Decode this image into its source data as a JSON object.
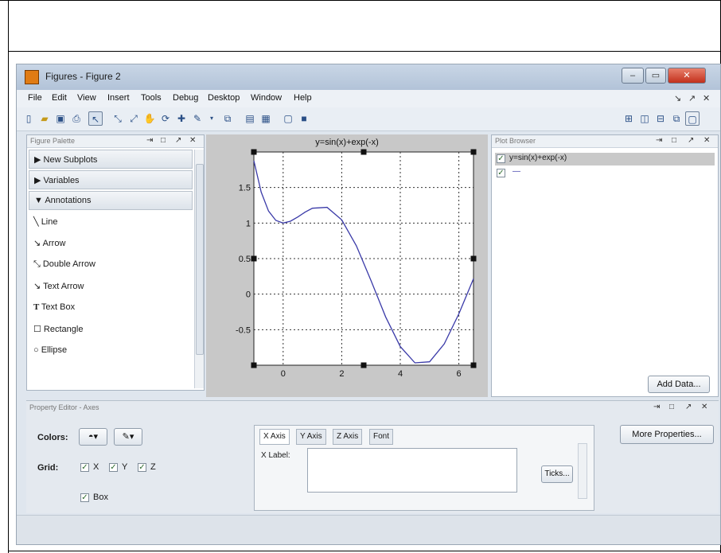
{
  "window": {
    "title": "Figures - Figure 2"
  },
  "menu": [
    "File",
    "Edit",
    "View",
    "Insert",
    "Tools",
    "Debug",
    "Desktop",
    "Window",
    "Help"
  ],
  "menu_right": [
    "↘",
    "↗",
    "✕"
  ],
  "palette": {
    "title": "Figure Palette",
    "sections": [
      "New Subplots",
      "Variables",
      "Annotations"
    ],
    "annotations": [
      "Line",
      "Arrow",
      "Double Arrow",
      "Text Arrow",
      "Text Box",
      "Rectangle",
      "Ellipse"
    ]
  },
  "plot": {
    "title": "y=sin(x)+exp(-x)",
    "yticks": [
      "1.5",
      "1",
      "0.5",
      "0",
      "-0.5"
    ],
    "xticks": [
      "0",
      "2",
      "4",
      "6"
    ]
  },
  "chart_data": {
    "type": "line",
    "title": "y=sin(x)+exp(-x)",
    "xlabel": "",
    "ylabel": "",
    "xlim": [
      -1,
      6.5
    ],
    "ylim": [
      -1,
      2
    ],
    "grid": true,
    "series": [
      {
        "name": "y=sin(x)+exp(-x)",
        "x": [
          -1,
          -0.75,
          -0.5,
          -0.25,
          0,
          0.25,
          0.5,
          0.75,
          1,
          1.5,
          2,
          2.5,
          3,
          3.5,
          4,
          4.5,
          5,
          5.5,
          6,
          6.5
        ],
        "y": [
          1.877,
          1.436,
          1.169,
          1.037,
          1.0,
          1.026,
          1.086,
          1.154,
          1.209,
          1.221,
          1.045,
          0.68,
          0.191,
          -0.321,
          -0.738,
          -0.966,
          -0.952,
          -0.701,
          -0.277,
          0.217
        ]
      }
    ],
    "color": "#3a3aa8"
  },
  "browser": {
    "title": "Plot Browser",
    "items": [
      "y=sin(x)+exp(-x)",
      "—"
    ],
    "add_data": "Add Data..."
  },
  "property_editor": {
    "title": "Property Editor - Axes",
    "colors_label": "Colors:",
    "grid_label": "Grid:",
    "grid_x": "X",
    "grid_y": "Y",
    "grid_z": "Z",
    "box": "Box",
    "tabs": [
      "X Axis",
      "Y Axis",
      "Z Axis",
      "Font"
    ],
    "xlabel_label": "X Label:",
    "ticks": "Ticks...",
    "more": "More Properties..."
  }
}
